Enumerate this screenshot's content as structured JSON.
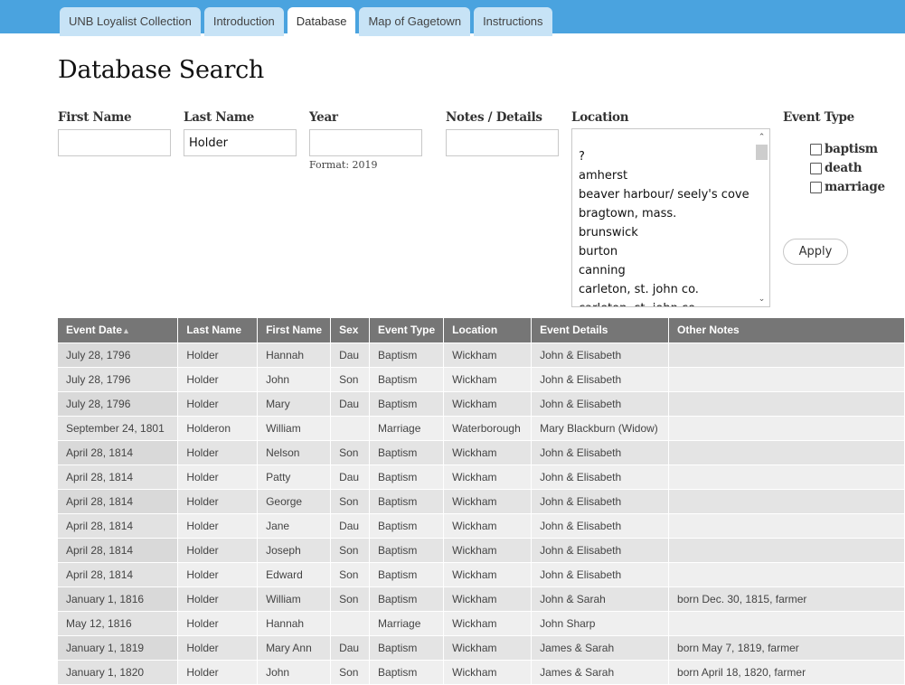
{
  "nav": {
    "tabs": [
      {
        "label": "UNB Loyalist Collection",
        "active": false
      },
      {
        "label": "Introduction",
        "active": false
      },
      {
        "label": "Database",
        "active": true
      },
      {
        "label": "Map of Gagetown",
        "active": false
      },
      {
        "label": "Instructions",
        "active": false
      }
    ]
  },
  "page": {
    "title": "Database Search"
  },
  "search": {
    "first_name": {
      "label": "First Name",
      "value": ""
    },
    "last_name": {
      "label": "Last Name",
      "value": "Holder"
    },
    "year": {
      "label": "Year",
      "value": "",
      "hint": "Format: 2019"
    },
    "notes": {
      "label": "Notes / Details",
      "value": ""
    },
    "location": {
      "label": "Location",
      "options": [
        "",
        "?",
        "amherst",
        "beaver harbour/ seely's cove",
        "bragtown, mass.",
        "brunswick",
        "burton",
        "canning",
        "carleton, st. john co.",
        "carleton, st. john co."
      ]
    },
    "event_type": {
      "label": "Event Type",
      "options": [
        {
          "label": "baptism",
          "checked": false
        },
        {
          "label": "death",
          "checked": false
        },
        {
          "label": "marriage",
          "checked": false
        }
      ]
    },
    "apply_label": "Apply"
  },
  "results": {
    "sort_arrow": "▲",
    "columns": [
      "Event Date",
      "Last Name",
      "First Name",
      "Sex",
      "Event Type",
      "Location",
      "Event Details",
      "Other Notes"
    ],
    "rows": [
      [
        "July 28, 1796",
        "Holder",
        "Hannah",
        "Dau",
        "Baptism",
        "Wickham",
        "John & Elisabeth",
        ""
      ],
      [
        "July 28, 1796",
        "Holder",
        "John",
        "Son",
        "Baptism",
        "Wickham",
        "John & Elisabeth",
        ""
      ],
      [
        "July 28, 1796",
        "Holder",
        "Mary",
        "Dau",
        "Baptism",
        "Wickham",
        "John & Elisabeth",
        ""
      ],
      [
        "September 24, 1801",
        "Holderon",
        "William",
        "",
        "Marriage",
        "Waterborough",
        "Mary Blackburn (Widow)",
        ""
      ],
      [
        "April 28, 1814",
        "Holder",
        "Nelson",
        "Son",
        "Baptism",
        "Wickham",
        "John & Elisabeth",
        ""
      ],
      [
        "April 28, 1814",
        "Holder",
        "Patty",
        "Dau",
        "Baptism",
        "Wickham",
        "John & Elisabeth",
        ""
      ],
      [
        "April 28, 1814",
        "Holder",
        "George",
        "Son",
        "Baptism",
        "Wickham",
        "John & Elisabeth",
        ""
      ],
      [
        "April 28, 1814",
        "Holder",
        "Jane",
        "Dau",
        "Baptism",
        "Wickham",
        "John & Elisabeth",
        ""
      ],
      [
        "April 28, 1814",
        "Holder",
        "Joseph",
        "Son",
        "Baptism",
        "Wickham",
        "John & Elisabeth",
        ""
      ],
      [
        "April 28, 1814",
        "Holder",
        "Edward",
        "Son",
        "Baptism",
        "Wickham",
        "John & Elisabeth",
        ""
      ],
      [
        "January 1, 1816",
        "Holder",
        "William",
        "Son",
        "Baptism",
        "Wickham",
        "John & Sarah",
        "born Dec. 30, 1815, farmer"
      ],
      [
        "May 12, 1816",
        "Holder",
        "Hannah",
        "",
        "Marriage",
        "Wickham",
        "John Sharp",
        ""
      ],
      [
        "January 1, 1819",
        "Holder",
        "Mary Ann",
        "Dau",
        "Baptism",
        "Wickham",
        "James & Sarah",
        "born May 7, 1819, farmer"
      ],
      [
        "January 1, 1820",
        "Holder",
        "John",
        "Son",
        "Baptism",
        "Wickham",
        "James & Sarah",
        "born April 18, 1820, farmer"
      ]
    ]
  }
}
